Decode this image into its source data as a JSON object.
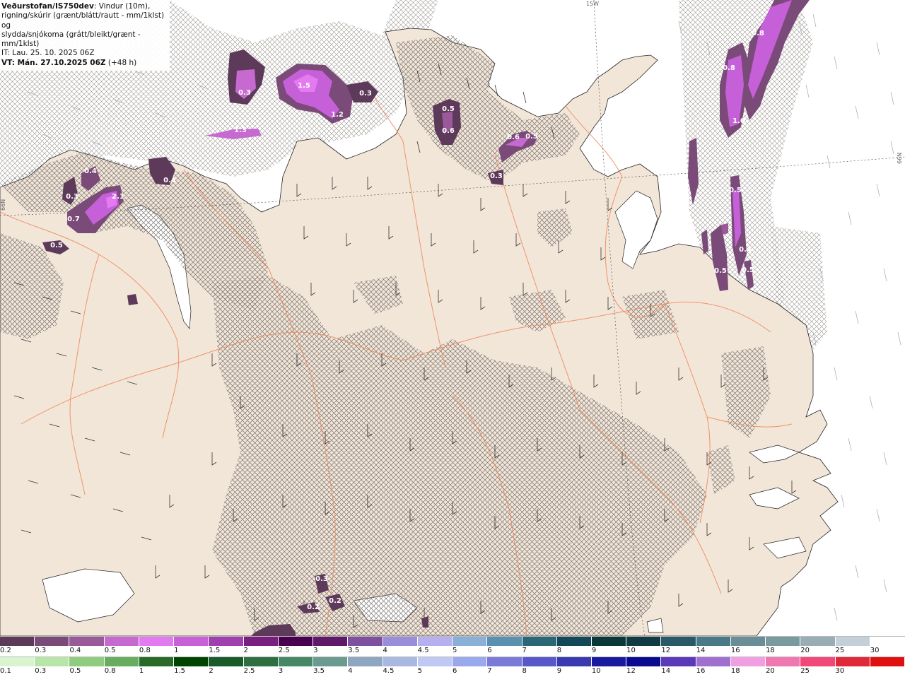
{
  "header": {
    "title": "Veðurstofan/IS750dev",
    "desc_1": ": Vindur (10m),",
    "desc_2": "rigning/skúrir (grænt/blátt/rautt - mm/1klst) og",
    "desc_3": "slydda/snjókoma (grátt/bleikt/grænt - mm/1klst)",
    "it_line": "IT: Lau. 25. 10. 2025 06Z",
    "vt_label": "VT: Mán. 27.10.2025 06Z",
    "vt_offset": " (+48 h)"
  },
  "grid_labels": {
    "lon_15w": "15W",
    "lat_left": "66N",
    "lat_right": "66N"
  },
  "precip_labels": [
    "0.3",
    "1.5",
    "0.3",
    "1.2",
    "1.3",
    "0.5",
    "0.6",
    "0.6",
    "0.5",
    "0.3",
    "0.4",
    "0.3",
    "2.1",
    "0.7",
    "0.5",
    "0.4",
    "0.5",
    "0.8",
    "0.8",
    "1.0",
    "0.5",
    "0.5",
    "0.4",
    "0.3",
    "0.2",
    "0.2"
  ],
  "legend_snow": {
    "labels": [
      "0.2",
      "0.3",
      "0.4",
      "0.5",
      "0.8",
      "1",
      "1.5",
      "2",
      "2.5",
      "3",
      "3.5",
      "4",
      "4.5",
      "5",
      "6",
      "7",
      "8",
      "9",
      "10",
      "12",
      "14",
      "16",
      "18",
      "20",
      "25",
      "30"
    ],
    "colors": [
      "#5e3a5a",
      "#7a4a78",
      "#9a5a9a",
      "#c66ad0",
      "#e47af0",
      "#c860d8",
      "#a040b0",
      "#7a1e80",
      "#4a0050",
      "#601868",
      "#8050a0",
      "#9a8ed8",
      "#b6b0f0",
      "#8ab0d8",
      "#5a90b0",
      "#2a6878",
      "#144858",
      "#0a3838",
      "#103a44",
      "#285a68",
      "#4a7a88",
      "#6a8e98",
      "#7a9aa0",
      "#98aeb4",
      "#c4d0d8",
      "#ffffff"
    ]
  },
  "legend_rain": {
    "labels": [
      "0.1",
      "0.3",
      "0.5",
      "0.8",
      "1",
      "1.5",
      "2",
      "2.5",
      "3",
      "3.5",
      "4",
      "4.5",
      "5",
      "6",
      "7",
      "8",
      "9",
      "10",
      "12",
      "14",
      "16",
      "18",
      "20",
      "25",
      "30"
    ],
    "colors": [
      "#d8f5d0",
      "#b8e6a8",
      "#90cc80",
      "#68ac60",
      "#2a6a28",
      "#004400",
      "#1a5a2a",
      "#2e6e40",
      "#468866",
      "#6a9a90",
      "#8ea6c0",
      "#a8b8e0",
      "#c0c8f4",
      "#9aa8ec",
      "#7a7ad8",
      "#5858c8",
      "#3a3ab0",
      "#1a1aa0",
      "#0a0a90",
      "#5a3ab8",
      "#a070d0",
      "#f0a0e0",
      "#f078b0",
      "#f04878",
      "#e02838",
      "#e01010"
    ]
  }
}
